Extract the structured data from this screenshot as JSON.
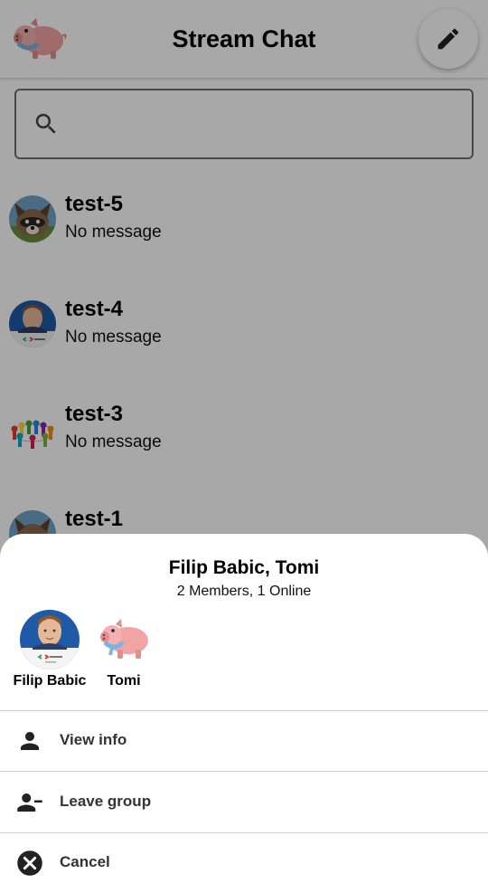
{
  "app": {
    "title": "Stream Chat"
  },
  "icons": {
    "logo": "pig-mascot-icon",
    "compose": "pencil-icon",
    "search": "search-icon",
    "view_info": "person-icon",
    "leave_group": "person-remove-icon",
    "cancel": "cancel-circle-icon"
  },
  "search": {
    "value": "",
    "placeholder": ""
  },
  "channels": [
    {
      "name": "test-5",
      "last_message": "No message",
      "avatar": "raccoon-avatar"
    },
    {
      "name": "test-4",
      "last_message": "No message",
      "avatar": "person-photo-avatar"
    },
    {
      "name": "test-3",
      "last_message": "No message",
      "avatar": "group-circle-avatar"
    },
    {
      "name": "test-1",
      "last_message": "",
      "avatar": "raccoon-avatar"
    }
  ],
  "sheet": {
    "title": "Filip Babic, Tomi",
    "subtitle": "2 Members, 1 Online",
    "members": [
      {
        "name": "Filip Babic",
        "avatar": "person-photo-avatar"
      },
      {
        "name": "Tomi",
        "avatar": "pig-mascot-avatar"
      }
    ],
    "actions": [
      {
        "label": "View info"
      },
      {
        "label": "Leave group"
      },
      {
        "label": "Cancel"
      }
    ]
  },
  "colors": {
    "scrim": "#000000",
    "sheet_bg": "#ffffff",
    "pig_pink": "#f2a3a3",
    "scarf_blue": "#7fb2e0"
  }
}
